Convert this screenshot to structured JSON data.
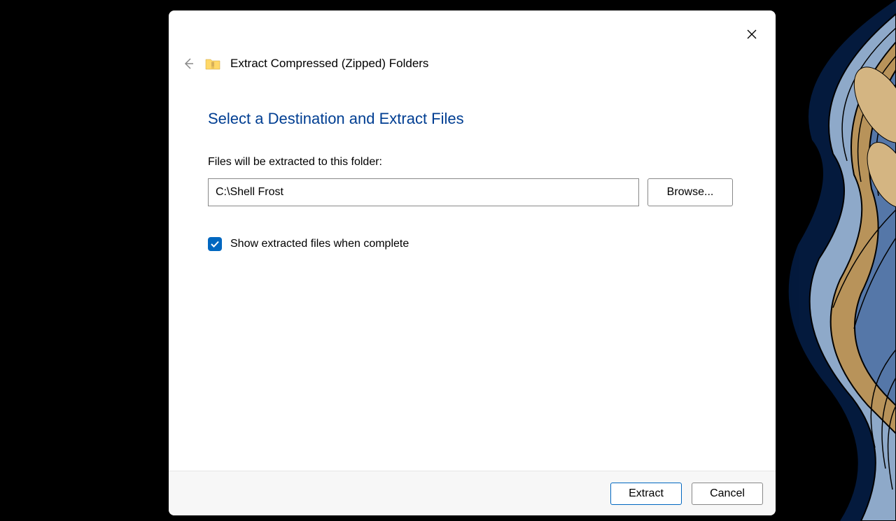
{
  "dialog": {
    "wizard_title": "Extract Compressed (Zipped) Folders",
    "heading": "Select a Destination and Extract Files",
    "field_label": "Files will be extracted to this folder:",
    "path_value": "C:\\Shell Frost",
    "browse_label": "Browse...",
    "checkbox_checked": true,
    "checkbox_label": "Show extracted files when complete",
    "extract_label": "Extract",
    "cancel_label": "Cancel"
  }
}
